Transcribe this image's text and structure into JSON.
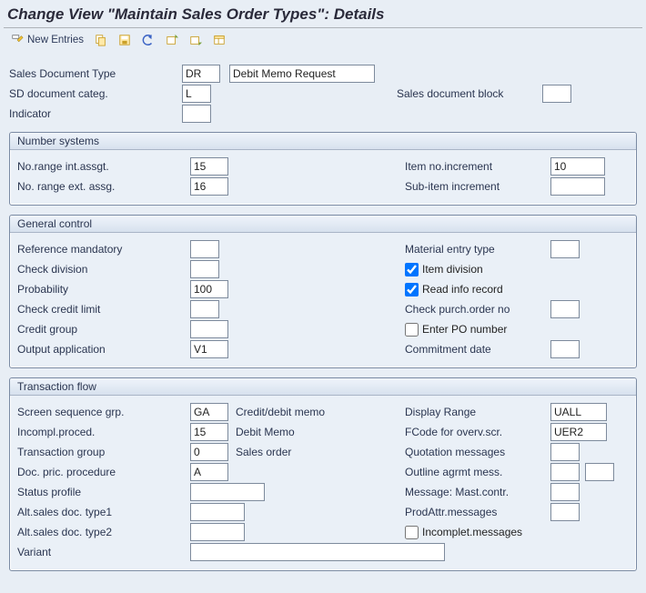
{
  "title": "Change View \"Maintain Sales Order Types\": Details",
  "toolbar": {
    "toggle_label": "New Entries"
  },
  "top": {
    "sales_doc_type_lbl": "Sales Document Type",
    "sales_doc_type_val": "DR",
    "sales_doc_type_desc": "Debit Memo Request",
    "sd_doc_categ_lbl": "SD document categ.",
    "sd_doc_categ_val": "L",
    "sales_block_lbl": "Sales document block",
    "sales_block_val": "",
    "indicator_lbl": "Indicator",
    "indicator_val": ""
  },
  "number_systems": {
    "title": "Number systems",
    "no_range_int_lbl": "No.range int.assgt.",
    "no_range_int_val": "15",
    "item_incr_lbl": "Item no.increment",
    "item_incr_val": "10",
    "no_range_ext_lbl": "No. range ext. assg.",
    "no_range_ext_val": "16",
    "sub_item_incr_lbl": "Sub-item increment",
    "sub_item_incr_val": ""
  },
  "general_control": {
    "title": "General control",
    "ref_mand_lbl": "Reference mandatory",
    "ref_mand_val": "",
    "mat_entry_lbl": "Material entry type",
    "mat_entry_val": "",
    "check_div_lbl": "Check division",
    "check_div_val": "",
    "item_div_lbl": "Item division",
    "item_div_chk": true,
    "probability_lbl": "Probability",
    "probability_val": "100",
    "read_info_lbl": "Read info record",
    "read_info_chk": true,
    "check_credit_lbl": "Check credit limit",
    "check_credit_val": "",
    "check_po_lbl": "Check purch.order no",
    "check_po_val": "",
    "credit_group_lbl": "Credit group",
    "credit_group_val": "",
    "enter_po_lbl": "Enter PO number",
    "enter_po_chk": false,
    "output_app_lbl": "Output application",
    "output_app_val": "V1",
    "commit_date_lbl": "Commitment  date",
    "commit_date_val": ""
  },
  "transaction_flow": {
    "title": "Transaction flow",
    "screen_seq_lbl": "Screen sequence grp.",
    "screen_seq_val": "GA",
    "screen_seq_desc": "Credit/debit memo",
    "display_range_lbl": "Display Range",
    "display_range_val": "UALL",
    "incompl_lbl": "Incompl.proced.",
    "incompl_val": "15",
    "incompl_desc": "Debit Memo",
    "fcode_lbl": "FCode for overv.scr.",
    "fcode_val": "UER2",
    "trans_group_lbl": "Transaction group",
    "trans_group_val": "0",
    "trans_group_desc": "Sales order",
    "quot_msg_lbl": "Quotation messages",
    "quot_msg_val": "",
    "doc_pric_lbl": "Doc. pric. procedure",
    "doc_pric_val": "A",
    "outline_lbl": "Outline agrmt mess.",
    "outline_val1": "",
    "outline_val2": "",
    "status_prof_lbl": "Status profile",
    "status_prof_val": "",
    "mast_contr_lbl": "Message: Mast.contr.",
    "mast_contr_val": "",
    "alt_sales1_lbl": "Alt.sales doc. type1",
    "alt_sales1_val": "",
    "prod_attr_lbl": "ProdAttr.messages",
    "prod_attr_val": "",
    "alt_sales2_lbl": "Alt.sales doc. type2",
    "alt_sales2_val": "",
    "incompl_msg_lbl": "Incomplet.messages",
    "incompl_msg_chk": false,
    "variant_lbl": "Variant",
    "variant_val": ""
  }
}
